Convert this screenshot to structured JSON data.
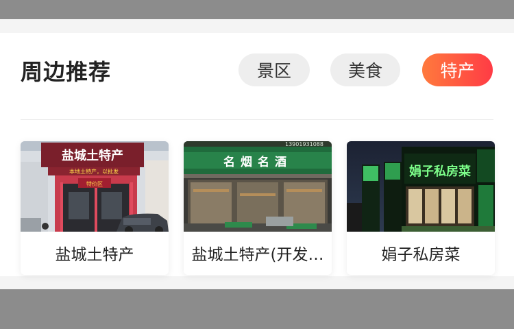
{
  "section": {
    "title": "周边推荐"
  },
  "tabs": [
    {
      "label": "景区",
      "active": false
    },
    {
      "label": "美食",
      "active": false
    },
    {
      "label": "特产",
      "active": true
    }
  ],
  "places": [
    {
      "name": "盐城土特产",
      "photo_sign": "盐城土特产",
      "photo_banner": "本地土特产，以批发",
      "photo_small_sign": "特价区"
    },
    {
      "name": "盐城土特产(开发…",
      "photo_sign": "名烟名酒",
      "photo_phone": "13901931088"
    },
    {
      "name": "娟子私房菜",
      "photo_sign": "娟子私房菜"
    }
  ],
  "colors": {
    "accent_start": "#ff7a3d",
    "accent_end": "#ff3b45",
    "tab_bg": "#eeeeee"
  }
}
